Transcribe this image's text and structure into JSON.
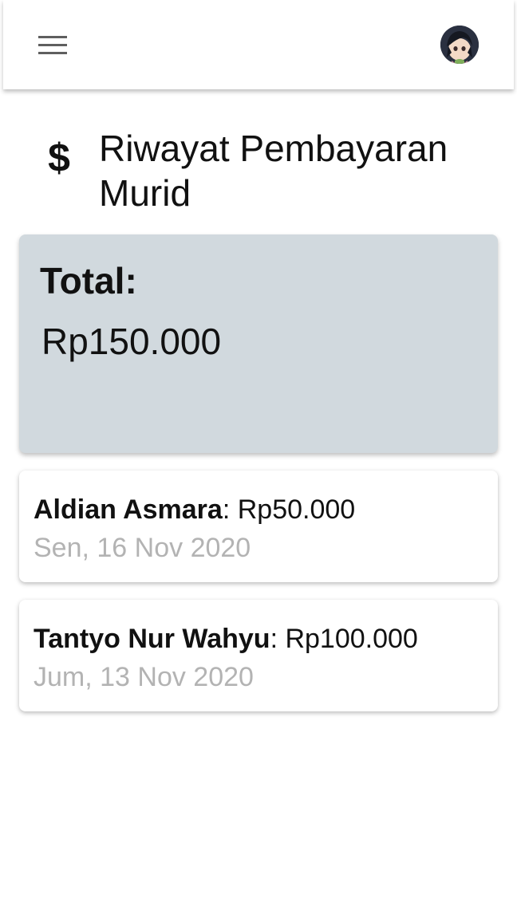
{
  "appbar": {
    "menu_icon": "hamburger-menu-icon",
    "avatar_icon": "user-avatar"
  },
  "page": {
    "icon": "$",
    "title": "Riwayat Pembayaran Murid"
  },
  "total": {
    "label": "Total:",
    "value": "Rp150.000"
  },
  "payments": [
    {
      "name": "Aldian Asmara",
      "separator": ": ",
      "amount": "Rp50.000",
      "date": "Sen, 16 Nov 2020"
    },
    {
      "name": "Tantyo Nur Wahyu",
      "separator": ": ",
      "amount": "Rp100.000",
      "date": "Jum, 13 Nov 2020"
    }
  ]
}
